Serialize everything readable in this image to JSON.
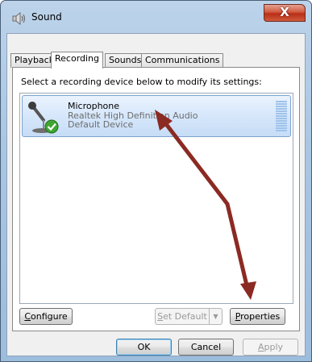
{
  "window": {
    "title": "Sound",
    "close_label": "X"
  },
  "tabs": [
    {
      "label": "Playback"
    },
    {
      "label": "Recording"
    },
    {
      "label": "Sounds"
    },
    {
      "label": "Communications"
    }
  ],
  "active_tab": "Recording",
  "instruction": "Select a recording device below to modify its settings:",
  "devices": [
    {
      "name": "Microphone",
      "description": "Realtek High Definition Audio",
      "status": "Default Device",
      "icon": "microphone-icon",
      "badge_icon": "check-icon"
    }
  ],
  "buttons": {
    "configure": {
      "prefix": "",
      "mnemonic": "C",
      "rest": "onfigure"
    },
    "set_default": {
      "prefix": "",
      "mnemonic": "S",
      "rest": "et Default",
      "dropdown": "▼"
    },
    "properties": {
      "prefix": "",
      "mnemonic": "P",
      "rest": "roperties"
    },
    "ok": "OK",
    "cancel": "Cancel",
    "apply": {
      "prefix": "",
      "mnemonic": "A",
      "rest": "pply"
    }
  },
  "colors": {
    "annotation_arrow": "#8b2a23",
    "selection": "#cfe3fa",
    "close_button": "#c7442b",
    "check_badge": "#3fa632"
  }
}
